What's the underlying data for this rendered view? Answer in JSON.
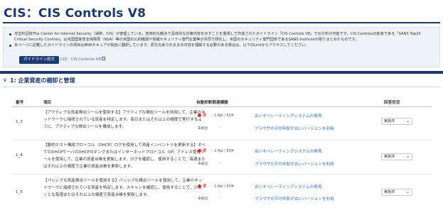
{
  "page": {
    "title": "CIS：CIS Controls V8"
  },
  "notice": {
    "items": [
      "非営利団体The Center for Internet Security（通称、CIS）が管理している、技術的な観点で具体的な対策内容を示すことを重視して作成されたガイドライン「CIS Controls V8」での分析が可能です。CIS Controlsの前身である「SANS Top20 Critical Security Controls」は米国国家安全保障局（NSA）等の米国の公的機関や情報セキュリティ専門企業等が共同で研究し、米国のセキュリティ専門団体であるSANS Instituteが取りまとめたものです。",
      "本ページに記載したガイドラインの項目はBNRセキュアが独自に翻訳しています。原文のありのままの内容を理解する必要のある場合は、以下のLinkからアクセスしてください。"
    ],
    "original_button": "ガイドライン原文",
    "v8_link": "CIS：CIS Controls V8"
  },
  "section": {
    "toggle": "∨",
    "title": "1: 企業資産の棚卸と管理"
  },
  "table": {
    "headers": {
      "no": "番号",
      "item": "項目",
      "auto": "自動診断関連課題",
      "status": "回答状況"
    },
    "rows": [
      {
        "no": "1_3",
        "desc": "【アクティブな資産検出ツールを使用する】アクティブな検出ツールを利用して、企業のネットワークに接続されている資産を特定します。毎日またはそれ以上の頻度で実行するように、アクティブな検出ツールを構成します。",
        "badge": "要",
        "score": "- 1.4pt / 63件",
        "unresolved": "未検出",
        "dash": "-",
        "issue1": "古いオペレーティングシステムの発見",
        "issue2": "ブラウザの平均年齢が古いバージョンを利用",
        "status": "実施済"
      },
      {
        "no": "1_4",
        "desc": "【動的ホスト構成プロトコル（DHCP）ログを使用して資産インベントリを更新する】すべてのDHCPサーバのDHCPロギングまたはインターネットプロトコル（IP）アドレス管理ツールを使用して、企業の資産台帳を更新します。ログを確認し、使用することで、毎週またはそれ以上の頻度で企業の資産台帳を更新します。",
        "badge": "要",
        "score": "- 1.4pt / 63件",
        "unresolved": "未検出",
        "dash": "-",
        "issue1": "古いオペレーティングシステムの発見",
        "issue2": "ブラウザの平均年齢が古いバージョンを利用",
        "status": "実施済"
      },
      {
        "no": "1_5",
        "desc": "【パッシブな資産検出ツールを使用する】パッシブな検出ツールを使用して、企業のネットワークに接続されている資産を特定します。スキャンを確認し、使用することで、少なくとも毎週またはそれ以上の頻度で資産台帳を更新します。",
        "badge": "要",
        "score": "- 1.4pt / 63件",
        "unresolved": "未検出",
        "dash": "-",
        "issue1": "古いオペレーティングシステムの発見",
        "issue2": "ブラウザの平均年齢が古いバージョンを利用",
        "status": "実施済"
      }
    ]
  },
  "icons": {
    "chevron": "chevron-down-icon",
    "external": "external-link-icon",
    "badge": "alert-dot-icon"
  },
  "colors": {
    "brand": "#1d3a6e",
    "link": "#2f6fb8",
    "alert": "#d12f2f",
    "notice_bg": "#eef3f9"
  }
}
